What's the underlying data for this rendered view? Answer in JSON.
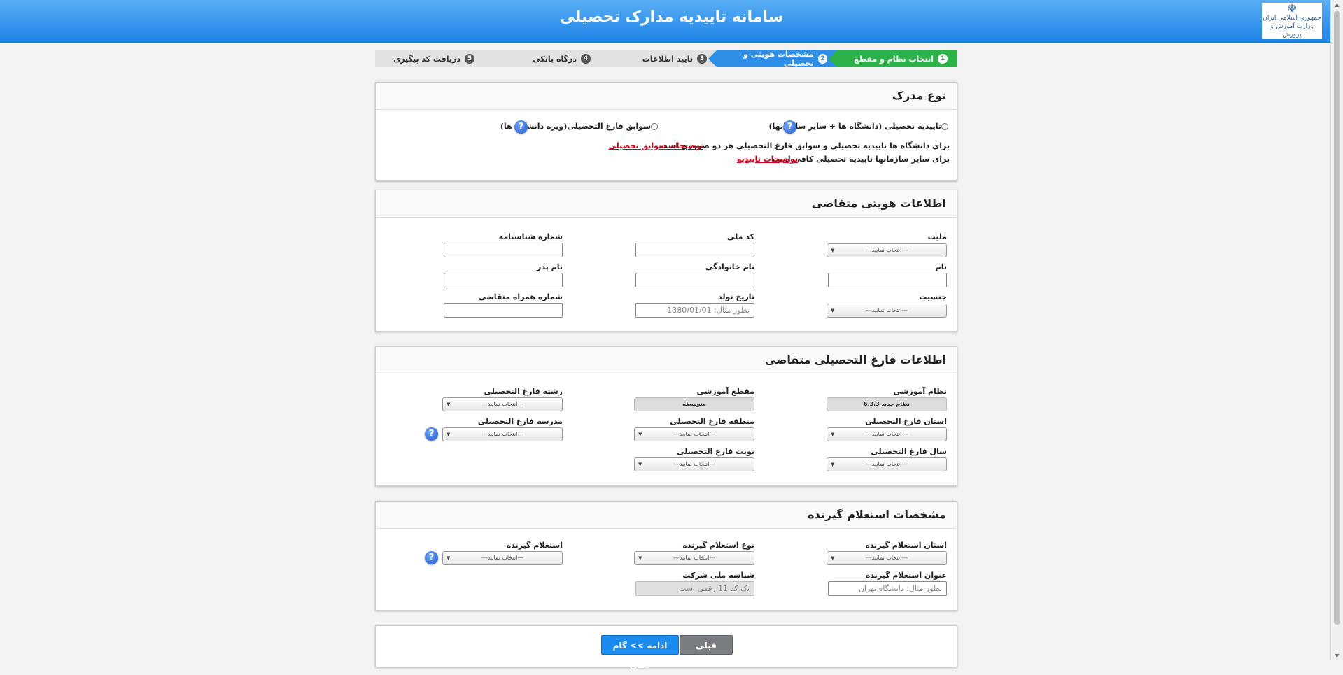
{
  "header": {
    "title": "سامانه تاییدیه مدارک تحصیلی",
    "logo_text_line1": "جمهوری اسلامی ایران",
    "logo_text_line2": "وزارت آموزش و پرورش"
  },
  "steps": [
    {
      "num": "1",
      "label": "انتخاب نظام و مقطع",
      "state": "done"
    },
    {
      "num": "2",
      "label": "مشخصات هویتی و تحصیلی",
      "state": "active"
    },
    {
      "num": "3",
      "label": "تایید اطلاعات",
      "state": "pending"
    },
    {
      "num": "4",
      "label": "درگاه بانکی",
      "state": "pending"
    },
    {
      "num": "5",
      "label": "دریافت کد پیگیری",
      "state": "pending"
    }
  ],
  "doc_type": {
    "title": "نوع مدرک",
    "option1": "تاییدیه تحصیلی (دانشگاه ها + سایر سازمانها)",
    "option2": "سوابق فارغ التحصیلی(ویژه دانشگاه ها)",
    "note1": "برای دانشگاه ها تاییدیه تحصیلی و سوابق فارغ التحصیلی هر دو ضروری است",
    "link1": "توضیحات سوابق تحصیلی",
    "note2": "برای سایر سازمانها تاییدیه تحصیلی کافی است",
    "link2": "توضیحات تاییدیه"
  },
  "identity": {
    "title": "اطلاعات هویتی متقاضی",
    "nationality_label": "ملیت",
    "national_code_label": "کد ملی",
    "id_number_label": "شماره شناسنامه",
    "first_name_label": "نام",
    "last_name_label": "نام خانوادگی",
    "father_name_label": "نام پدر",
    "gender_label": "جنسیت",
    "birth_date_label": "تاریخ تولد",
    "birth_date_placeholder": "بطور مثال: 1380/01/01",
    "mobile_label": "شماره همراه متقاضی"
  },
  "graduation": {
    "title": "اطلاعات فارغ التحصیلی متقاضی",
    "system_label": "نظام آموزشی",
    "system_value": "نظام جدید 6.3.3",
    "level_label": "مقطع آموزشی",
    "level_value": "متوسطه",
    "major_label": "رشته فارغ التحصیلی",
    "province_label": "استان فارغ التحصیلی",
    "region_label": "منطقه فارغ التحصیلی",
    "school_label": "مدرسه فارغ التحصیلی",
    "year_label": "سال فارغ التحصیلی",
    "turn_label": "نوبت فارغ التحصیلی"
  },
  "inquirer": {
    "title": "مشخصات استعلام گیرنده",
    "province_label": "استان استعلام گیرنده",
    "type_label": "نوع استعلام گیرنده",
    "inquirer_label": "استعلام گیرنده",
    "name_label": "عنوان استعلام گیرنده",
    "name_placeholder": "بطور مثال: دانشگاه تهران",
    "company_id_label": "شناسه ملی شرکت",
    "company_id_placeholder": "یک کد 11 رقمی است"
  },
  "select_placeholder": "---انتخاب نمایید---",
  "help_symbol": "?",
  "buttons": {
    "prev": "قبلی",
    "next": "ادامه >> گام بعدی"
  }
}
